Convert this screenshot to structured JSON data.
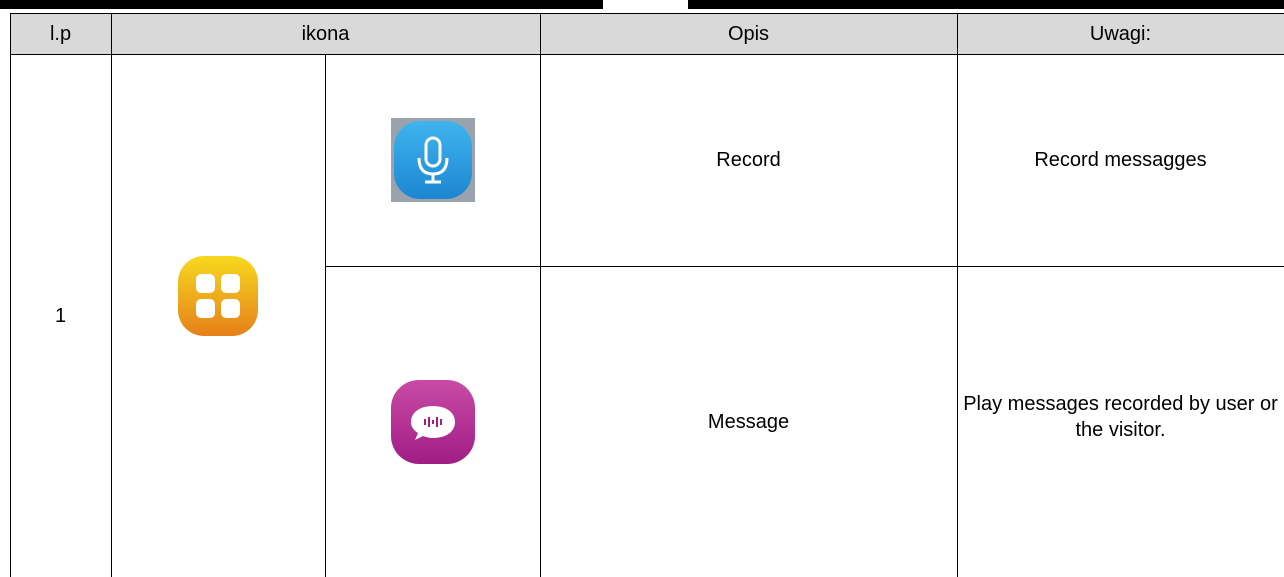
{
  "table": {
    "headers": {
      "lp": "l.p",
      "ikona": "ikona",
      "opis": "Opis",
      "uwagi": "Uwagi:"
    },
    "rows": [
      {
        "lp": "1",
        "group_icon": "apps-grid-icon",
        "items": [
          {
            "icon": "microphone-icon",
            "opis": "Record",
            "uwagi": "Record messagges"
          },
          {
            "icon": "chat-bubble-icon",
            "opis": "Message",
            "uwagi": "Play messages recorded by user or the visitor."
          }
        ]
      }
    ]
  },
  "colors": {
    "header_bg": "#d9d9d9",
    "apps_icon_top": "#f6d21c",
    "apps_icon_bottom": "#e8891a",
    "mic_icon": "#2a9ee0",
    "message_icon": "#b0268f"
  }
}
